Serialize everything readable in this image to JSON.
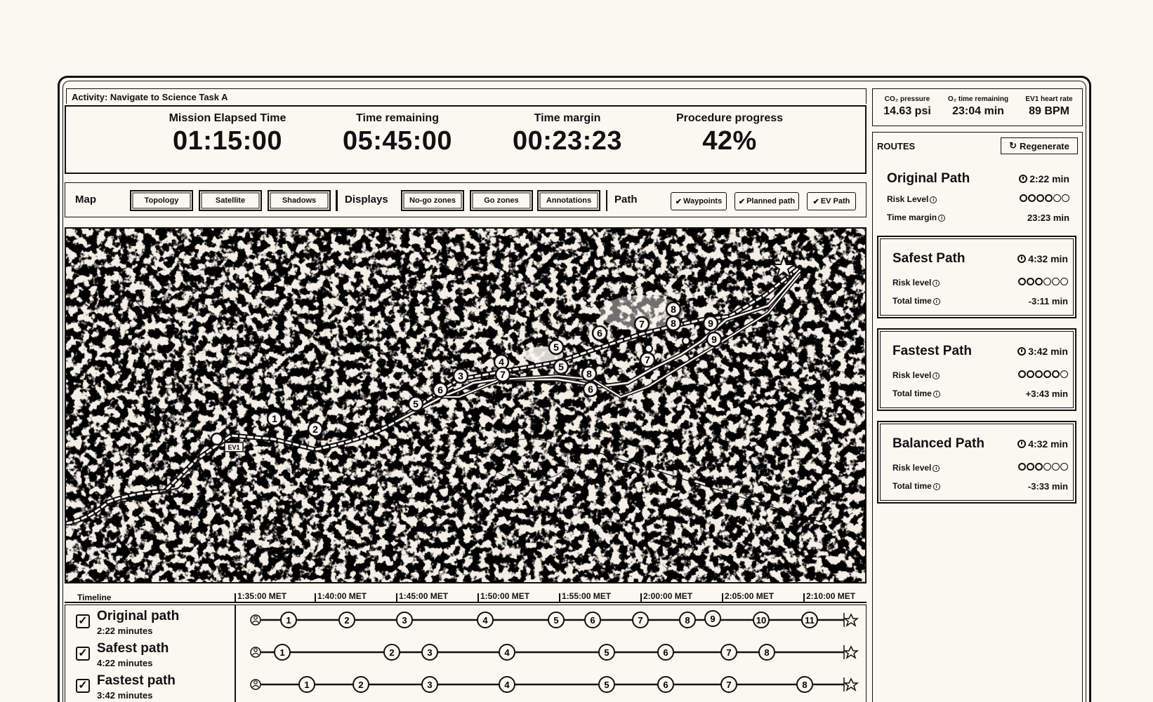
{
  "activity": "Activity: Navigate to Science Task A",
  "stats": [
    {
      "label": "Mission Elapsed Time",
      "value": "01:15:00"
    },
    {
      "label": "Time remaining",
      "value": "05:45:00"
    },
    {
      "label": "Time margin",
      "value": "00:23:23"
    },
    {
      "label": "Procedure progress",
      "value": "42%"
    }
  ],
  "toolbar": {
    "map_label": "Map",
    "map_buttons": [
      "Topology",
      "Satellite",
      "Shadows"
    ],
    "displays_label": "Displays",
    "display_buttons": [
      "No-go zones",
      "Go zones",
      "Annotations"
    ],
    "path_label": "Path",
    "path_toggles": [
      "Waypoints",
      "Planned path",
      "EV Path"
    ]
  },
  "map": {
    "ev_label": "EV1",
    "star_icon": "goal-star-icon"
  },
  "timeline": {
    "label": "Timeline",
    "ticks": [
      "1:35:00 MET",
      "1:40:00 MET",
      "1:45:00 MET",
      "1:50:00 MET",
      "1:55:00 MET",
      "2:00:00 MET",
      "2:05:00 MET",
      "2:10:00 MET"
    ],
    "rows": [
      {
        "name": "Original path",
        "duration": "2:22 minutes",
        "waypoints": [
          "1",
          "2",
          "3",
          "4",
          "5",
          "6",
          "7",
          "8",
          "9",
          "10",
          "11"
        ]
      },
      {
        "name": "Safest path",
        "duration": "4:22 minutes",
        "waypoints": [
          "1",
          "2",
          "3",
          "4",
          "5",
          "6",
          "7",
          "8"
        ]
      },
      {
        "name": "Fastest path",
        "duration": "3:42 minutes",
        "waypoints": [
          "1",
          "2",
          "3",
          "4",
          "5",
          "6",
          "7",
          "8"
        ]
      }
    ]
  },
  "sensors": [
    {
      "label": "CO₂ pressure",
      "value": "14.63 psi"
    },
    {
      "label": "O₂ time remaining",
      "value": "23:04 min"
    },
    {
      "label": "EV1 heart rate",
      "value": "89 BPM"
    }
  ],
  "routes": {
    "title": "ROUTES",
    "regenerate": "Regenerate",
    "items": [
      {
        "name": "Original Path",
        "time": "2:22 min",
        "risk_label": "Risk Level",
        "risk": 4,
        "second_label": "Time margin",
        "second_value": "23:23 min"
      },
      {
        "name": "Safest Path",
        "time": "4:32 min",
        "risk_label": "Risk level",
        "risk": 3,
        "second_label": "Total time",
        "second_value": "-3:11 min"
      },
      {
        "name": "Fastest Path",
        "time": "3:42 min",
        "risk_label": "Risk level",
        "risk": 5,
        "second_label": "Total time",
        "second_value": "+3:43 min"
      },
      {
        "name": "Balanced Path",
        "time": "4:32 min",
        "risk_label": "Risk level",
        "risk": 3,
        "second_label": "Total time",
        "second_value": "-3:33 min"
      }
    ]
  }
}
